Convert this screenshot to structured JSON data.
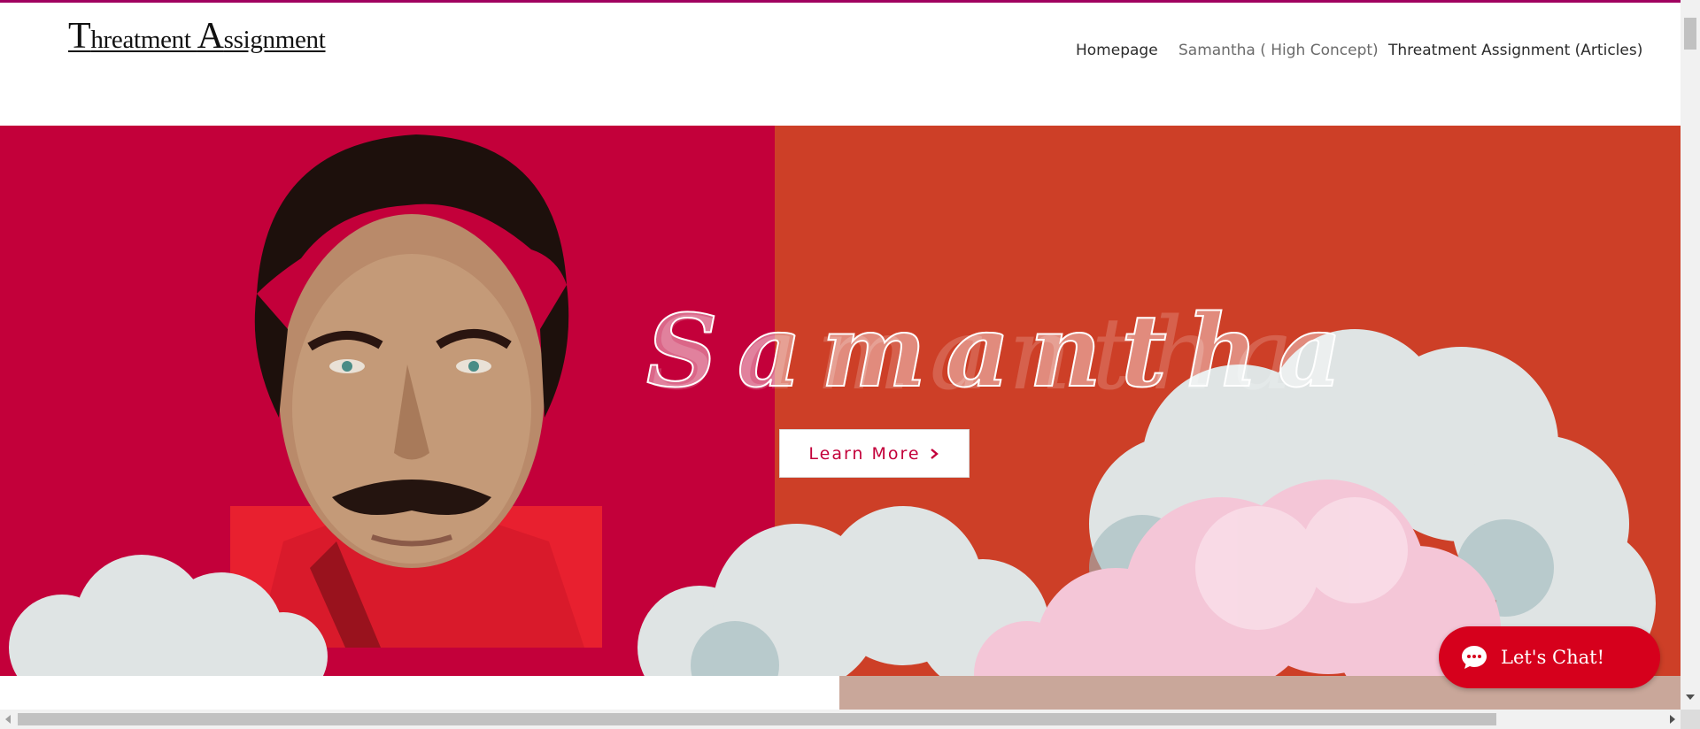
{
  "site": {
    "logo_cap1": "T",
    "logo_part1": "hreatment ",
    "logo_cap2": "A",
    "logo_part2": "ssignment"
  },
  "nav": {
    "items": [
      {
        "label": "Homepage"
      },
      {
        "label": "Samantha ( High Concept)"
      },
      {
        "label": "Threatment Assignment (Articles)"
      }
    ],
    "active_index": 1
  },
  "hero": {
    "title": "Samantha",
    "button_label": "Learn More",
    "button_icon": "chevron-right-icon"
  },
  "chat": {
    "label": "Let's Chat!",
    "icon": "chat-bubble-icon"
  },
  "colors": {
    "accent_line": "#a0005f",
    "hero_left": "#c3003a",
    "hero_right": "#cd3f27",
    "chat_button": "#d6001c"
  }
}
